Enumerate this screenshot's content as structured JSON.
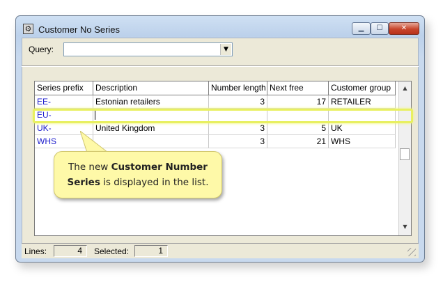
{
  "window": {
    "title": "Customer No Series",
    "icon": "gear-icon"
  },
  "titlebar_buttons": {
    "minimize_icon": "minimize-icon",
    "maximize_icon": "maximize-icon",
    "close_icon": "close-icon"
  },
  "query": {
    "label": "Query:",
    "value": ""
  },
  "grid": {
    "columns": [
      "Series prefix",
      "Description",
      "Number length",
      "Next free",
      "Customer group"
    ],
    "rows": [
      {
        "prefix": "EE-",
        "description": "Estonian retailers",
        "length": "3",
        "next_free": "17",
        "group": "RETAILER"
      },
      {
        "prefix": "EU-",
        "description": "",
        "length": "",
        "next_free": "",
        "group": ""
      },
      {
        "prefix": "UK-",
        "description": "United Kingdom",
        "length": "3",
        "next_free": "5",
        "group": "UK"
      },
      {
        "prefix": "WHS",
        "description": "",
        "length": "3",
        "next_free": "21",
        "group": "WHS"
      }
    ]
  },
  "callout": {
    "text_before": "The new ",
    "bold1": "Customer Number",
    "bold2": "Series",
    "text_after": " is displayed in the list."
  },
  "status": {
    "lines_label": "Lines:",
    "lines_value": "4",
    "selected_label": "Selected:",
    "selected_value": "1"
  },
  "colors": {
    "link": "#1a1acc",
    "highlight": "#e8f060",
    "callout_bg": "#fef9a8",
    "close_button": "#c8452c"
  }
}
